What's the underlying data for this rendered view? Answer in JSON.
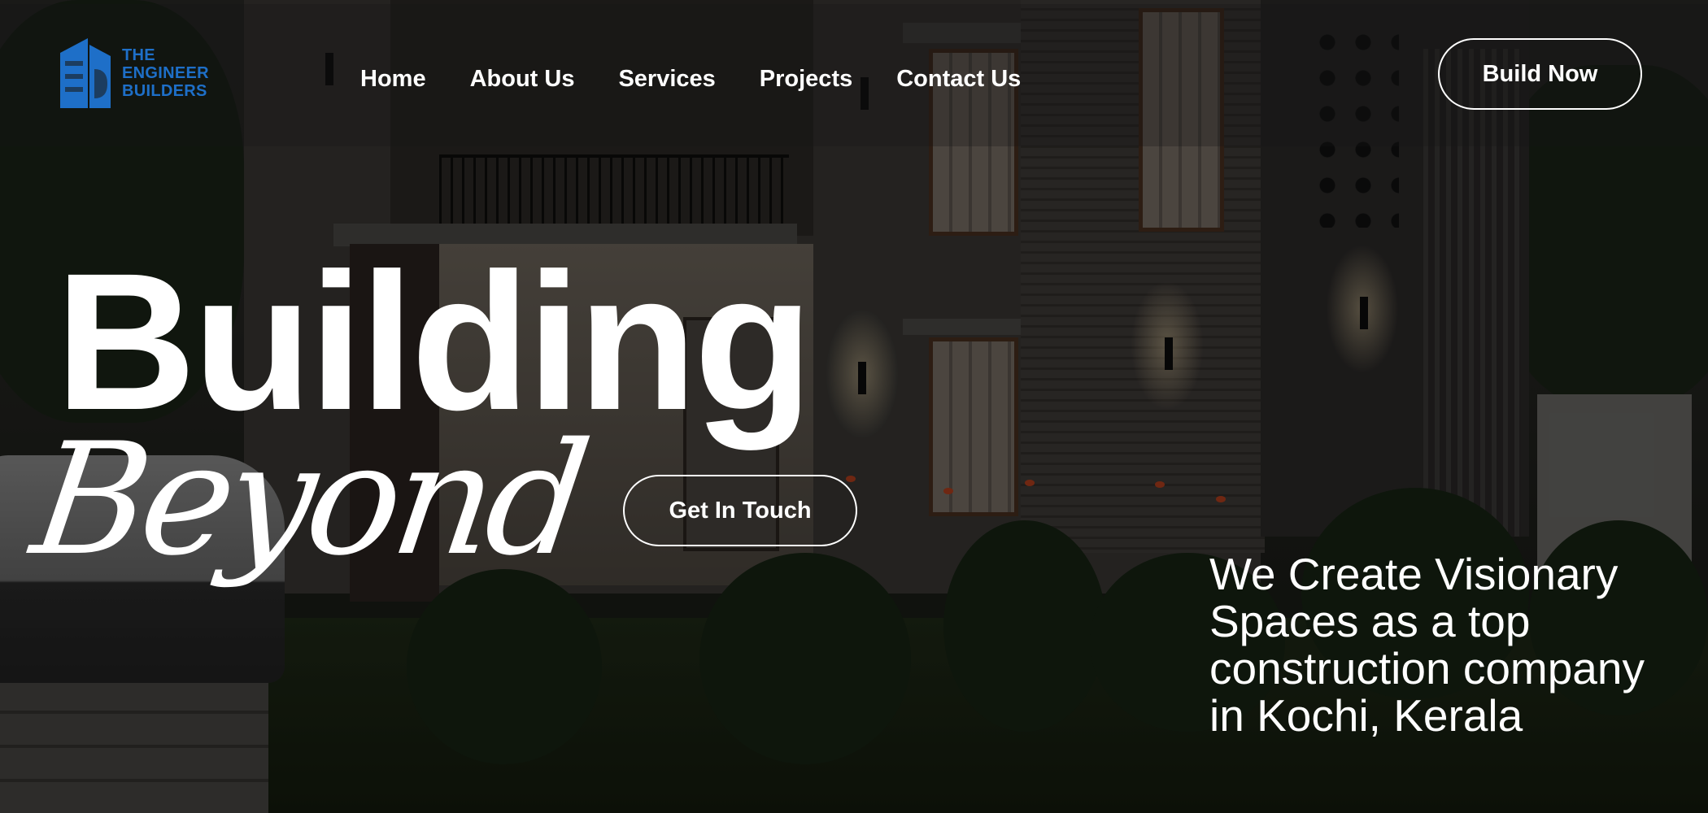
{
  "logo": {
    "line1": "THE",
    "line2": "ENGINEER",
    "line3": "BUILDERS",
    "color": "#1e6fc8",
    "icon": "building-logo-icon"
  },
  "nav": {
    "items": [
      {
        "label": "Home"
      },
      {
        "label": "About Us"
      },
      {
        "label": "Services"
      },
      {
        "label": "Projects"
      },
      {
        "label": "Contact Us"
      }
    ]
  },
  "header": {
    "cta_label": "Build Now"
  },
  "hero": {
    "title": "Building",
    "script": "Beyond",
    "cta_label": "Get In Touch",
    "tagline": "We Create Visionary Spaces as a top construction company in Kochi, Kerala"
  },
  "colors": {
    "text": "#ffffff",
    "overlay": "rgba(0,0,0,0.38)"
  }
}
